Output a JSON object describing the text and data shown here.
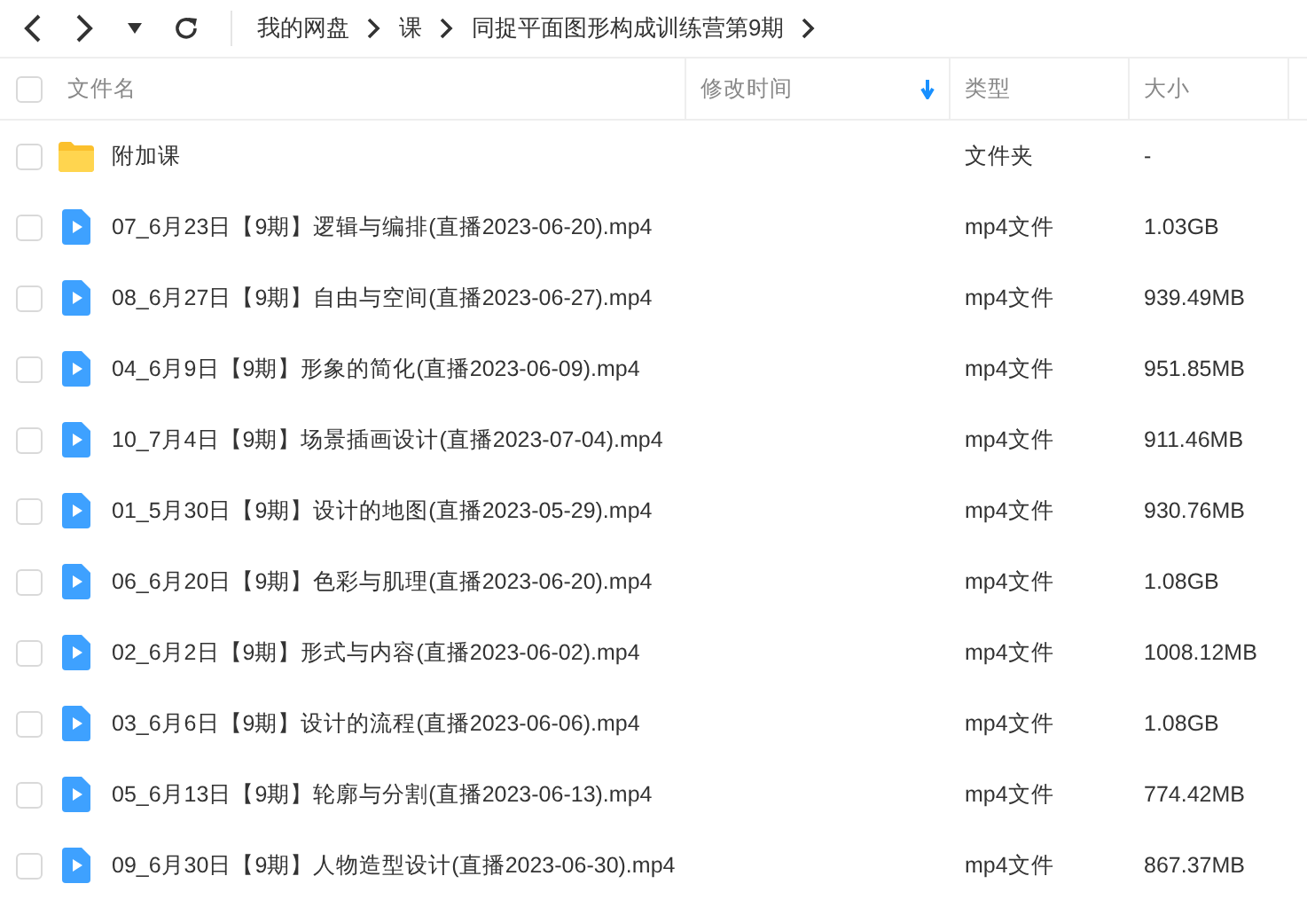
{
  "breadcrumb": [
    "我的网盘",
    "课",
    "同捉平面图形构成训练营第9期"
  ],
  "table": {
    "columns": [
      {
        "label": "文件名",
        "sorted": false
      },
      {
        "label": "修改时间",
        "sorted": true
      },
      {
        "label": "类型",
        "sorted": false
      },
      {
        "label": "大小",
        "sorted": false
      }
    ],
    "header_checked": false,
    "rows": [
      {
        "kind": "folder",
        "name": "附加课",
        "type": "文件夹",
        "size": "-",
        "checked": false
      },
      {
        "kind": "video",
        "name": "07_6月23日【9期】逻辑与编排(直播2023-06-20).mp4",
        "type": "mp4文件",
        "size": "1.03GB",
        "checked": false
      },
      {
        "kind": "video",
        "name": "08_6月27日【9期】自由与空间(直播2023-06-27).mp4",
        "type": "mp4文件",
        "size": "939.49MB",
        "checked": false
      },
      {
        "kind": "video",
        "name": "04_6月9日【9期】形象的简化(直播2023-06-09).mp4",
        "type": "mp4文件",
        "size": "951.85MB",
        "checked": false
      },
      {
        "kind": "video",
        "name": "10_7月4日【9期】场景插画设计(直播2023-07-04).mp4",
        "type": "mp4文件",
        "size": "911.46MB",
        "checked": false
      },
      {
        "kind": "video",
        "name": "01_5月30日【9期】设计的地图(直播2023-05-29).mp4",
        "type": "mp4文件",
        "size": "930.76MB",
        "checked": false
      },
      {
        "kind": "video",
        "name": "06_6月20日【9期】色彩与肌理(直播2023-06-20).mp4",
        "type": "mp4文件",
        "size": "1.08GB",
        "checked": false
      },
      {
        "kind": "video",
        "name": "02_6月2日【9期】形式与内容(直播2023-06-02).mp4",
        "type": "mp4文件",
        "size": "1008.12MB",
        "checked": false
      },
      {
        "kind": "video",
        "name": "03_6月6日【9期】设计的流程(直播2023-06-06).mp4",
        "type": "mp4文件",
        "size": "1.08GB",
        "checked": false
      },
      {
        "kind": "video",
        "name": "05_6月13日【9期】轮廓与分割(直播2023-06-13).mp4",
        "type": "mp4文件",
        "size": "774.42MB",
        "checked": false
      },
      {
        "kind": "video",
        "name": "09_6月30日【9期】人物造型设计(直播2023-06-30).mp4",
        "type": "mp4文件",
        "size": "867.37MB",
        "checked": false
      }
    ]
  }
}
